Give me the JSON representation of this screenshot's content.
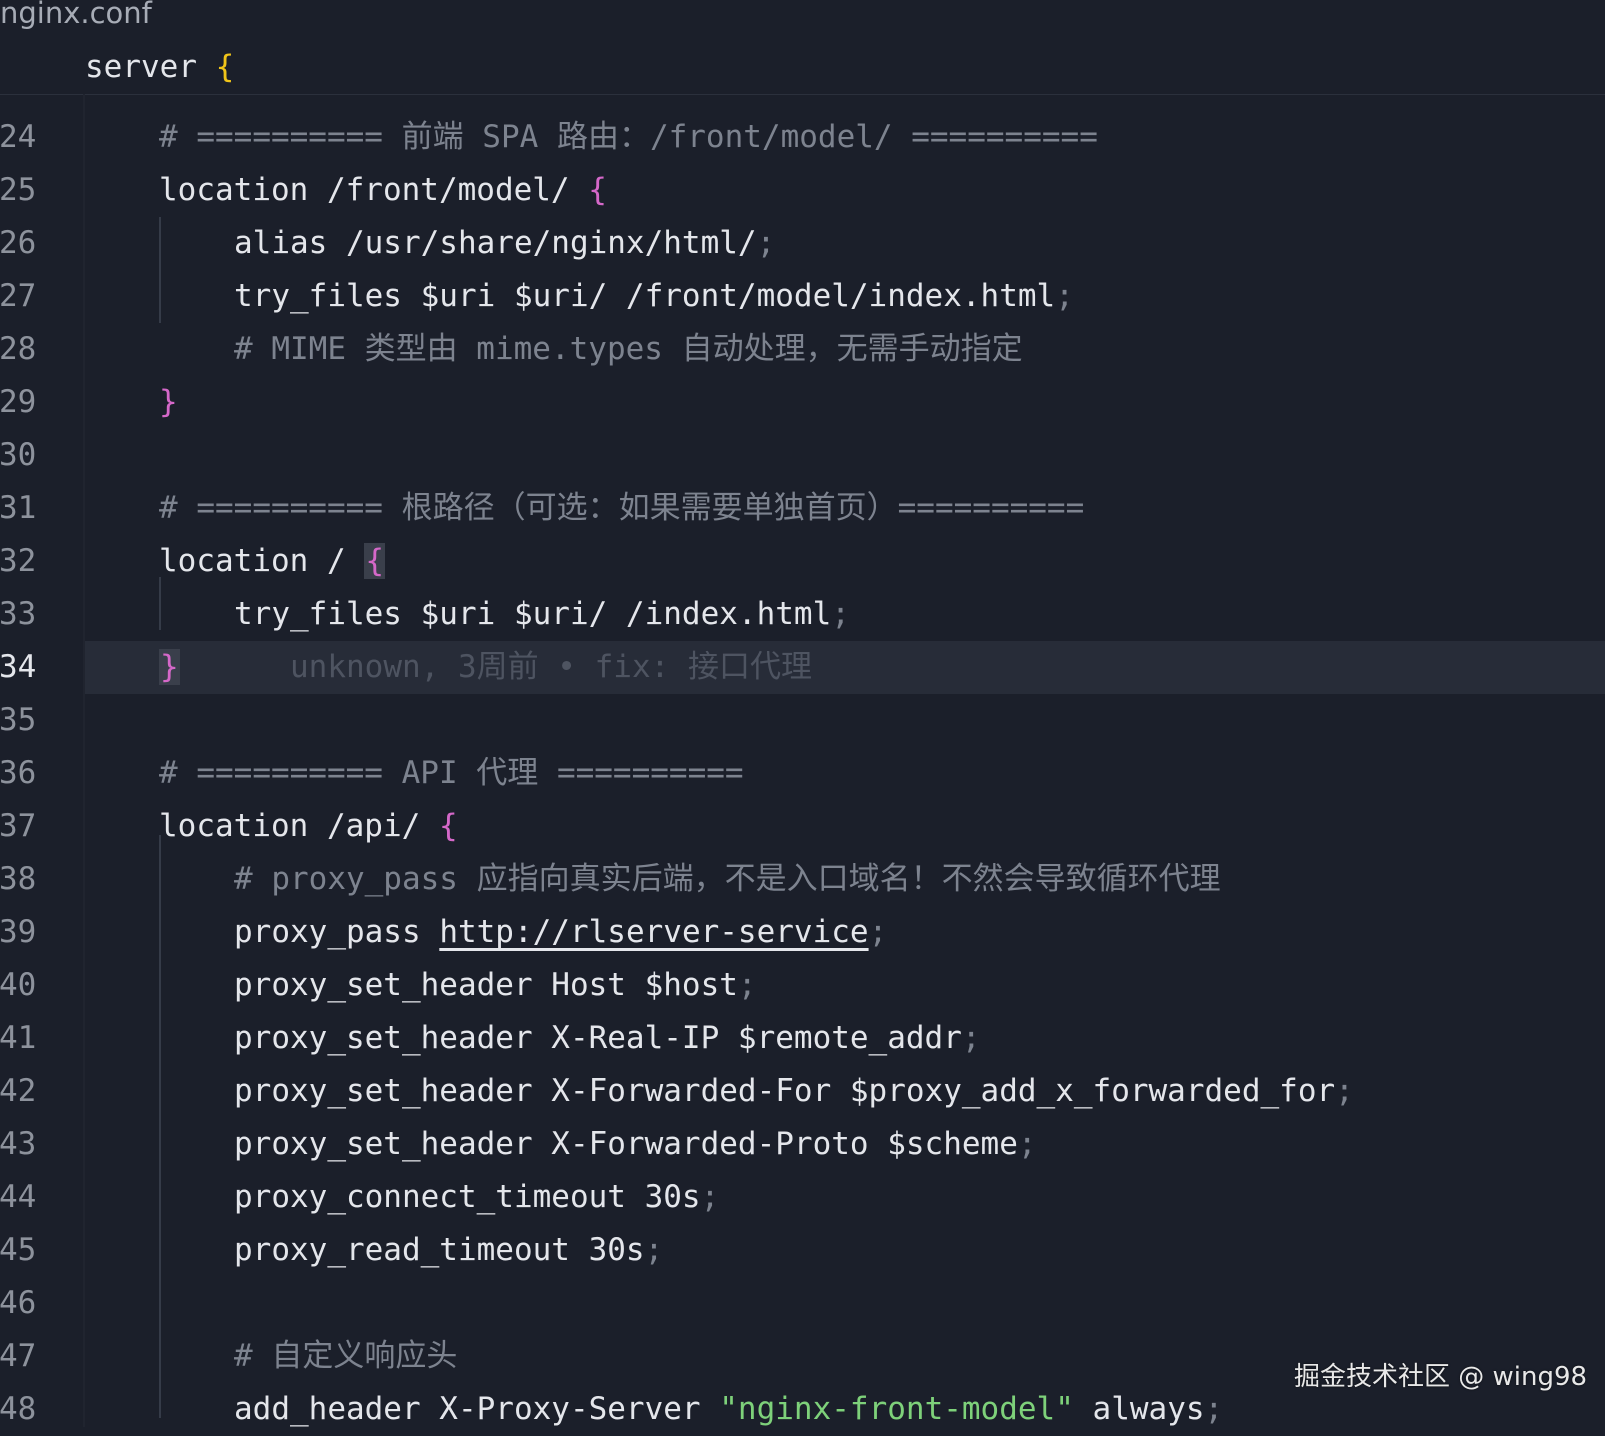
{
  "breadcrumb": "nginx.conf",
  "sticky": {
    "keyword": "server",
    "brace": "{"
  },
  "lines": [
    {
      "n": "24",
      "tokens": [
        "# ========== 前端 SPA 路由：/front/model/ =========="
      ]
    },
    {
      "n": "25",
      "tokens": [
        "location /front/model/ ",
        "{"
      ]
    },
    {
      "n": "26",
      "tokens": [
        "alias /usr/share/nginx/html/",
        ";"
      ]
    },
    {
      "n": "27",
      "tokens": [
        "try_files $uri $uri/ /front/model/index.html",
        ";"
      ]
    },
    {
      "n": "28",
      "tokens": [
        "# MIME 类型由 mime.types 自动处理，无需手动指定"
      ]
    },
    {
      "n": "29",
      "tokens": [
        "}"
      ]
    },
    {
      "n": "30",
      "tokens": []
    },
    {
      "n": "31",
      "tokens": [
        "# ========== 根路径（可选：如果需要单独首页）=========="
      ]
    },
    {
      "n": "32",
      "tokens": [
        "location / ",
        "{"
      ]
    },
    {
      "n": "33",
      "tokens": [
        "try_files $uri $uri/ /index.html",
        ";"
      ]
    },
    {
      "n": "34",
      "tokens": [
        "}"
      ],
      "blame": "unknown, 3周前 • fix: 接口代理"
    },
    {
      "n": "35",
      "tokens": []
    },
    {
      "n": "36",
      "tokens": [
        "# ========== API 代理 =========="
      ]
    },
    {
      "n": "37",
      "tokens": [
        "location /api/ ",
        "{"
      ]
    },
    {
      "n": "38",
      "tokens": [
        "# proxy_pass 应指向真实后端，不是入口域名！不然会导致循环代理"
      ]
    },
    {
      "n": "39",
      "tokens": [
        "proxy_pass ",
        "http://rlserver-service",
        ";"
      ]
    },
    {
      "n": "40",
      "tokens": [
        "proxy_set_header Host $host",
        ";"
      ]
    },
    {
      "n": "41",
      "tokens": [
        "proxy_set_header X-Real-IP $remote_addr",
        ";"
      ]
    },
    {
      "n": "42",
      "tokens": [
        "proxy_set_header X-Forwarded-For $proxy_add_x_forwarded_for",
        ";"
      ]
    },
    {
      "n": "43",
      "tokens": [
        "proxy_set_header X-Forwarded-Proto $scheme",
        ";"
      ]
    },
    {
      "n": "44",
      "tokens": [
        "proxy_connect_timeout 30s",
        ";"
      ]
    },
    {
      "n": "45",
      "tokens": [
        "proxy_read_timeout 30s",
        ";"
      ]
    },
    {
      "n": "46",
      "tokens": []
    },
    {
      "n": "47",
      "tokens": [
        "# 自定义响应头"
      ]
    },
    {
      "n": "48",
      "tokens": [
        "add_header X-Proxy-Server ",
        "\"nginx-front-model\"",
        " always",
        ";"
      ]
    }
  ],
  "watermark": "掘金技术社区 @ wing98",
  "colors": {
    "background": "#1b1f2a",
    "current_line": "#272c38",
    "comment": "#7d838f",
    "text": "#e4e6eb",
    "brace_outer": "#f0c419",
    "brace_inner": "#d568c9",
    "string": "#7ed17a"
  }
}
